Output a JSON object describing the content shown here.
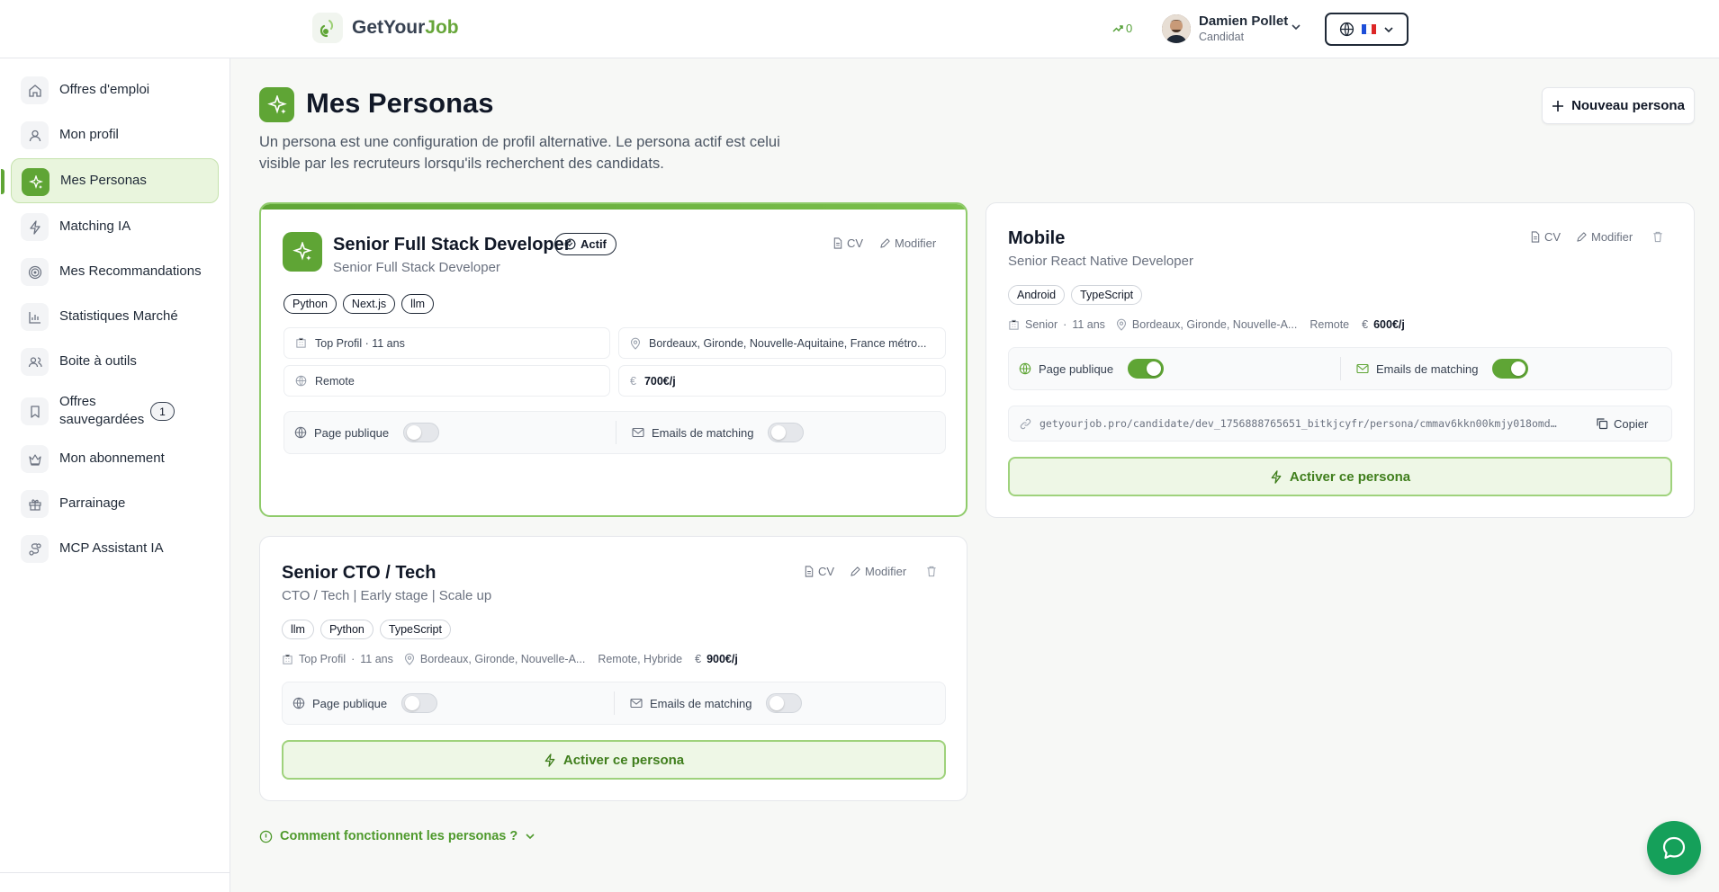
{
  "header": {
    "brand_part1": "GetYour",
    "brand_part2": "Job",
    "trend_count": "0",
    "user_name": "Damien Pollet",
    "user_role": "Candidat"
  },
  "sidebar": {
    "items": [
      {
        "label": "Offres d'emploi"
      },
      {
        "label": "Mon profil"
      },
      {
        "label": "Mes Personas"
      },
      {
        "label": "Matching IA"
      },
      {
        "label": "Mes Recommandations"
      },
      {
        "label": "Statistiques Marché"
      },
      {
        "label": "Boite à outils"
      },
      {
        "label": "Offres sauvegardées",
        "badge": "1"
      },
      {
        "label": "Mon abonnement"
      },
      {
        "label": "Parrainage"
      },
      {
        "label": "MCP Assistant IA"
      }
    ],
    "active_index": 2
  },
  "page": {
    "title": "Mes Personas",
    "description": "Un persona est une configuration de profil alternative. Le persona actif est celui visible par les recruteurs lorsqu'ils recherchent des candidats.",
    "new_button": "Nouveau persona",
    "howto": "Comment fonctionnent les personas ?"
  },
  "personas": [
    {
      "name": "Senior Full Stack Developer",
      "subtitle": "Senior Full Stack Developer",
      "active_label": "Actif",
      "cv_label": "CV",
      "edit_label": "Modifier",
      "tags": [
        "Python",
        "Next.js",
        "llm"
      ],
      "level": "Top Profil · 11 ans",
      "location": "Bordeaux, Gironde, Nouvelle-Aquitaine, France métro...",
      "remote": "Remote",
      "rate": "700€/j",
      "public_label": "Page publique",
      "public_on": false,
      "emails_label": "Emails de matching",
      "emails_on": false
    },
    {
      "name": "Mobile",
      "subtitle": "Senior React Native Developer",
      "cv_label": "CV",
      "edit_label": "Modifier",
      "tags": [
        "Android",
        "TypeScript"
      ],
      "level": "Senior",
      "years": "11 ans",
      "location": "Bordeaux, Gironde, Nouvelle-A...",
      "remote": "Remote",
      "rate": "600€/j",
      "public_label": "Page publique",
      "public_on": true,
      "emails_label": "Emails de matching",
      "emails_on": true,
      "url": "getyourjob.pro/candidate/dev_1756888765651_bitkjcyfr/persona/cmmav6kkn00kmjy018omd…",
      "copy_label": "Copier",
      "activate_label": "Activer ce persona"
    },
    {
      "name": "Senior CTO / Tech",
      "subtitle": "CTO / Tech | Early stage | Scale up",
      "cv_label": "CV",
      "edit_label": "Modifier",
      "tags": [
        "llm",
        "Python",
        "TypeScript"
      ],
      "level": "Top Profil",
      "years": "11 ans",
      "location": "Bordeaux, Gironde, Nouvelle-A...",
      "remote": "Remote, Hybride",
      "rate": "900€/j",
      "public_label": "Page publique",
      "public_on": false,
      "emails_label": "Emails de matching",
      "emails_on": false,
      "activate_label": "Activer ce persona"
    }
  ],
  "colors": {
    "accent": "#5fa535",
    "accent_light": "#eef7e6",
    "chat": "#15a05a"
  }
}
